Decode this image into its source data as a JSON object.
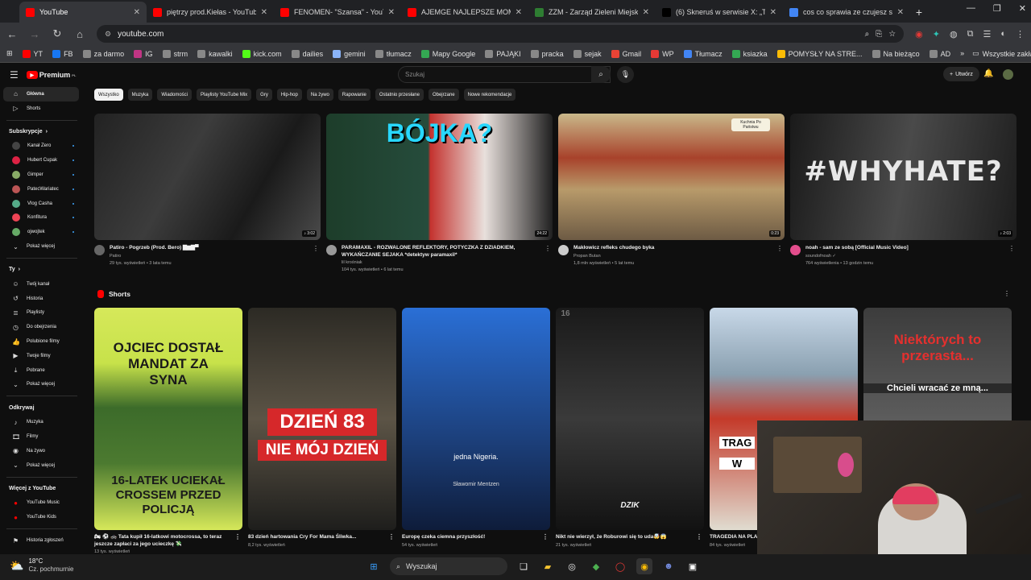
{
  "browser": {
    "tabs": [
      {
        "title": "YouTube",
        "color": "#ff0000"
      },
      {
        "title": "piętrzy prod.Kiełas - YouTube",
        "color": "#ff0000"
      },
      {
        "title": "FENOMEN- \"Szansa\" - YouTube",
        "color": "#ff0000"
      },
      {
        "title": "AJEMGE NAJLEPSZE MOMENTY",
        "color": "#ff0000"
      },
      {
        "title": "ZZM - Zarząd Zieleni Miejskiej w",
        "color": "#2e7d32"
      },
      {
        "title": "(6) Skneruś w serwisie X: „Tak",
        "color": "#000000"
      },
      {
        "title": "cos co sprawia ze czujesz sie tr",
        "color": "#4285f4"
      }
    ],
    "new_tab": "+",
    "url": "youtube.com",
    "bookmarks": [
      "YT",
      "FB",
      "za darmo",
      "IG",
      "strm",
      "kawalki",
      "kick.com",
      "dailies",
      "gemini",
      "tłumacz",
      "Mapy Google",
      "PAJĄKI",
      "pracka",
      "sejak",
      "Gmail",
      "WP",
      "Tłumacz",
      "ksiazka",
      "POMYSŁY NA STRE...",
      "Na bieżąco",
      "AD"
    ],
    "all_bookmarks": "Wszystkie zakładki"
  },
  "yt": {
    "logo": "Premium",
    "logo_sup": "PL",
    "search_placeholder": "Szukaj",
    "create": "Utwórz",
    "sidebar": {
      "main": [
        "Główna",
        "Shorts"
      ],
      "subs_head": "Subskrypcje",
      "subs": [
        "Kanał Zero",
        "Hubert Cupak",
        "Gimper",
        "PatecWariatec",
        "Vlog Casha",
        "Konfitura",
        "ojwojtek",
        "Pokaż więcej"
      ],
      "you_head": "Ty",
      "you": [
        "Twój kanał",
        "Historia",
        "Playlisty",
        "Do obejrzenia",
        "Polubione filmy",
        "Twoje filmy",
        "Pobrane",
        "Pokaż więcej"
      ],
      "sub_head": "Odkrywaj",
      "explore": [
        "Muzyka",
        "Filmy",
        "Na żywo",
        "Pokaż więcej"
      ],
      "more_head": "Więcej z YouTube",
      "more": [
        "YouTube Music",
        "YouTube Kids"
      ],
      "report": "Historia zgłoszeń"
    },
    "chips": [
      "Wszystko",
      "Muzyka",
      "Wiadomości",
      "Playlisty YouTube Mix",
      "Gry",
      "Hip-hop",
      "Na żywo",
      "Rapowanie",
      "Ostatnio przesłane",
      "Obejrzane",
      "Nowe rekomendacje"
    ],
    "videos": [
      {
        "title": "Patiro - Pogrzeb (Prod. Bero) ▇▆▇▀",
        "channel": "Patiro",
        "meta": "29 tys. wyświetleń • 3 lata temu",
        "duration": "♪ 3:02",
        "overlay": ""
      },
      {
        "title": "PARAMAXIL - ROZWALONE REFLEKTORY, POTYCZKA Z DZIADKIEM, WYKAŃCZANIE SEJAKA *detektyw paramaxil*",
        "channel": "lil krośniak",
        "meta": "104 tys. wyświetleń • 6 lat temu",
        "duration": "24:22",
        "overlay": "BÓJKA?"
      },
      {
        "title": "Makłowicz refleks chudego byka",
        "channel": "Propan Butan",
        "meta": "1,8 mln wyświetleń • 5 lat temu",
        "duration": "0:23",
        "overlay": "Kuchnia Po Państwu"
      },
      {
        "title": "noah - sam ze sobą [Official Music Video]",
        "channel": "soundofnoah ✓",
        "meta": "764 wyświetlenia • 13 godzin temu",
        "duration": "♪ 2:03",
        "overlay": "#WHYHATE?"
      }
    ],
    "shorts_label": "Shorts",
    "shorts": [
      {
        "title": "🏍 ⚽ 🚓 Tata kupił 16-latkowi motocrossa, to teraz jeszcze zapłaci za jego ucieczkę 💸",
        "meta": "13 tys. wyświetleń",
        "top": "OJCIEC DOSTAŁ MANDAT ZA SYNA",
        "bottom": "16-LATEK UCIEKAŁ CROSSEM PRZED POLICJĄ"
      },
      {
        "title": "83 dzień hartowania Cry For Mama Śliwka...",
        "meta": "8,2 tys. wyświetleń",
        "top": "DZIEŃ 83",
        "bottom": "NIE MÓJ DZIEŃ"
      },
      {
        "title": "Europę czeka ciemna przyszłość!",
        "meta": "54 tys. wyświetleń",
        "top": "jedna Nigeria.",
        "bottom": "Sławomir Mentzen"
      },
      {
        "title": "Nikt nie wierzył, że Roburowi się to uda🤯😱",
        "meta": "21 tys. wyświetleń",
        "top": "16",
        "bottom": "DZIK"
      },
      {
        "title": "TRAGEDIA NA PLAŻY",
        "meta": "84 tys. wyświetleń",
        "top": "TRAG",
        "bottom": "W"
      },
      {
        "title": "",
        "meta": "",
        "top": "Niektórych to przerasta...",
        "bottom": "Chcieli wracać ze mną..."
      }
    ]
  },
  "taskbar": {
    "temp": "18°C",
    "weather": "Cz. pochmurnie",
    "search": "Wyszukaj"
  }
}
